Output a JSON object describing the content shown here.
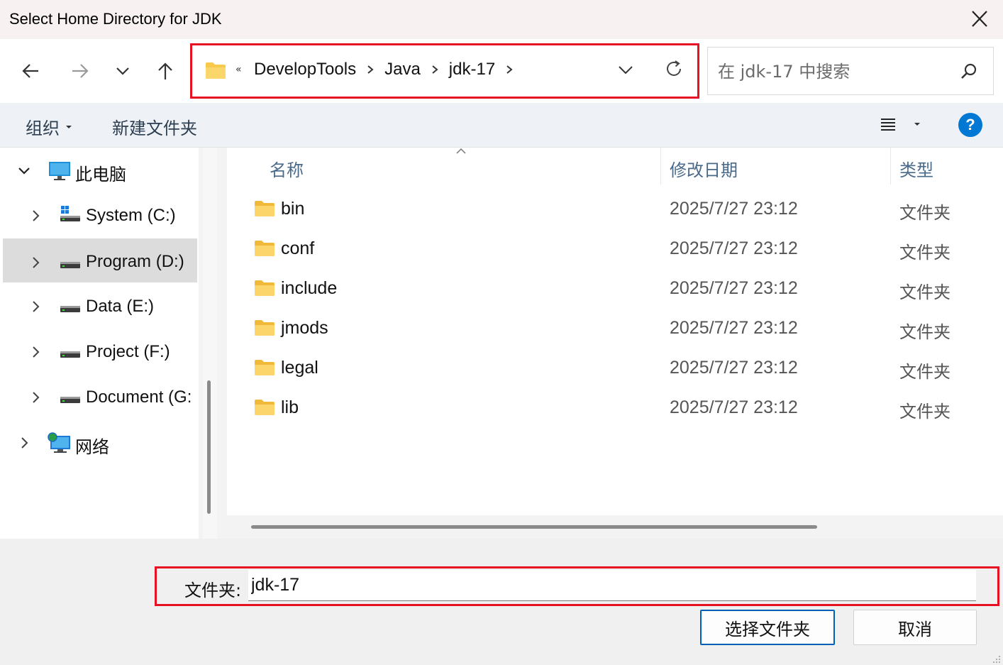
{
  "window": {
    "title": "Select Home Directory for JDK"
  },
  "nav": {
    "breadcrumb_overflow": "«",
    "breadcrumbs": [
      "DevelopTools",
      "Java",
      "jdk-17"
    ]
  },
  "search": {
    "placeholder": "在 jdk-17 中搜索"
  },
  "toolbar": {
    "organize_label": "组织",
    "new_folder_label": "新建文件夹",
    "help_label": "?"
  },
  "sidebar": {
    "items": [
      {
        "label": "此电脑",
        "level": 0,
        "expanded": true
      },
      {
        "label": "System (C:)",
        "level": 1
      },
      {
        "label": "Program (D:)",
        "level": 1,
        "selected": true
      },
      {
        "label": "Data (E:)",
        "level": 1
      },
      {
        "label": "Project (F:)",
        "level": 1
      },
      {
        "label": "Document (G:",
        "level": 1
      },
      {
        "label": "网络",
        "level": 0
      }
    ]
  },
  "filelist": {
    "columns": {
      "name": "名称",
      "date": "修改日期",
      "type": "类型"
    },
    "rows": [
      {
        "name": "bin",
        "date": "2025/7/27 23:12",
        "type": "文件夹"
      },
      {
        "name": "conf",
        "date": "2025/7/27 23:12",
        "type": "文件夹"
      },
      {
        "name": "include",
        "date": "2025/7/27 23:12",
        "type": "文件夹"
      },
      {
        "name": "jmods",
        "date": "2025/7/27 23:12",
        "type": "文件夹"
      },
      {
        "name": "legal",
        "date": "2025/7/27 23:12",
        "type": "文件夹"
      },
      {
        "name": "lib",
        "date": "2025/7/27 23:12",
        "type": "文件夹"
      }
    ]
  },
  "footer": {
    "folder_label": "文件夹:",
    "folder_value": "jdk-17",
    "select_button": "选择文件夹",
    "cancel_button": "取消"
  },
  "colors": {
    "accent": "#005fb8",
    "highlight_outline": "#e81123",
    "folder": "#f8c94a"
  }
}
